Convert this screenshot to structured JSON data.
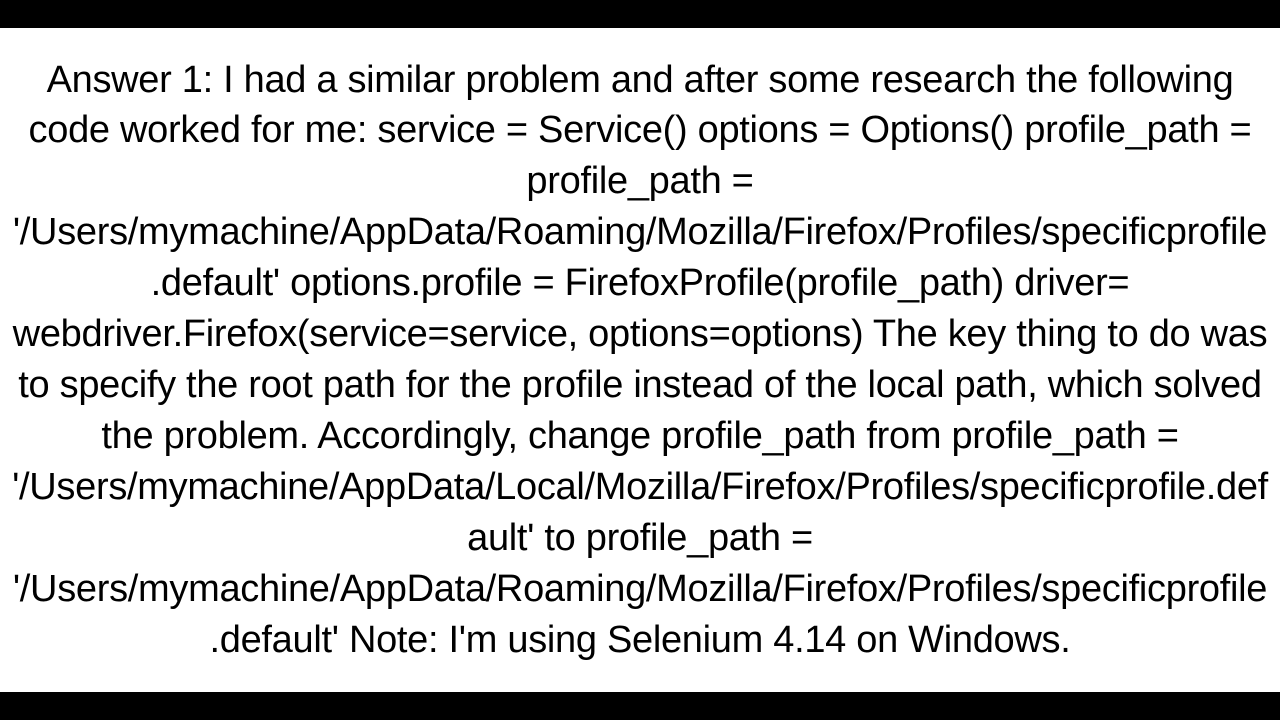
{
  "content": {
    "text": "Answer 1: I had a similar problem and after some research the following code worked for me: service = Service() options = Options() profile_path = profile_path = '/Users/mymachine/AppData/Roaming/Mozilla/Firefox/Profiles/specificprofile.default' options.profile = FirefoxProfile(profile_path) driver= webdriver.Firefox(service=service, options=options) The key thing to do was to specify the root path for the profile instead of the local path, which solved the problem. Accordingly, change profile_path from profile_path = '/Users/mymachine/AppData/Local/Mozilla/Firefox/Profiles/specificprofile.default'  to profile_path = '/Users/mymachine/AppData/Roaming/Mozilla/Firefox/Profiles/specificprofile.default' Note: I'm using Selenium 4.14 on Windows."
  }
}
